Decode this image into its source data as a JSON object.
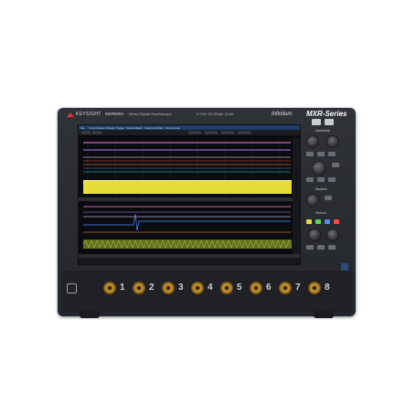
{
  "brand": {
    "name": "KEYSIGHT",
    "model": "MXR608A",
    "description": "Mixed Signal Oscilloscope",
    "specs": "6 GHz  16 GSa/s  10-bit"
  },
  "product_line": "Infiniium",
  "series": "MXR-Series",
  "screen": {
    "menu": [
      "File",
      "Control",
      "Setup",
      "Display",
      "Trigger",
      "Measure",
      "Math",
      "Analyze",
      "Utilities",
      "Demos",
      "Help"
    ]
  },
  "panel": {
    "horizontal_label": "Horizontal",
    "markers_label": "Markers",
    "vertical_label": "Vertical"
  },
  "channels": [
    {
      "number": "1"
    },
    {
      "number": "2"
    },
    {
      "number": "3"
    },
    {
      "number": "4"
    },
    {
      "number": "5"
    },
    {
      "number": "6"
    },
    {
      "number": "7"
    },
    {
      "number": "8"
    }
  ],
  "colors": {
    "ch1": "#f2e44a",
    "ch2": "#5fd35f",
    "ch3": "#4f8bff",
    "ch4": "#ff4a4a",
    "ch5": "#ff7ad9",
    "ch6": "#b07cff",
    "ch7": "#ffa640",
    "ch8": "#3fd6d6"
  }
}
